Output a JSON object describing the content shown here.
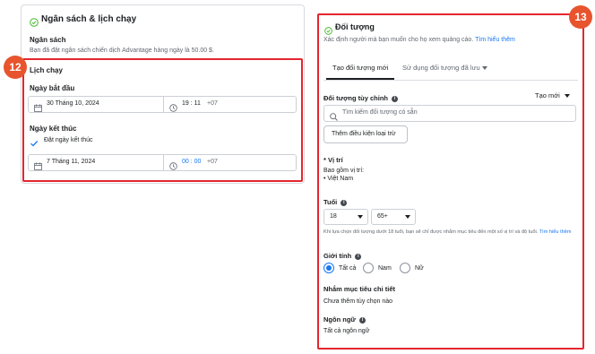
{
  "left_panel": {
    "title": "Ngân sách & lịch chạy",
    "budget_heading": "Ngân sách",
    "budget_text": "Bạn đã đặt ngân sách chiến dịch Advantage hàng ngày là 50.00 $.",
    "schedule_heading": "Lịch chạy",
    "start_label": "Ngày bắt đầu",
    "start_date": "30 Tháng 10, 2024",
    "start_time": "19 : 11",
    "start_tz": "+07",
    "end_label": "Ngày kết thúc",
    "end_checkbox_label": "Đặt ngày kết thúc",
    "end_date": "7 Tháng 11, 2024",
    "end_time": "00 : 00",
    "end_tz": "+07",
    "badge": "12"
  },
  "right_panel": {
    "title": "Đối tượng",
    "description": "Xác định người mà bạn muốn cho họ xem quảng cáo.",
    "learn_more": "Tìm hiểu thêm",
    "tabs": [
      "Tạo đối tượng mới",
      "Sử dụng đối tượng đã lưu"
    ],
    "custom_audience_label": "Đối tượng tùy chỉnh",
    "create_new": "Tạo mới",
    "search_placeholder": "Tìm kiếm đối tượng có sẵn",
    "exclude_button": "Thêm điều kiện loại trừ",
    "location_label": "Vị trí",
    "location_required_mark": "*",
    "location_include": "Bao gồm vị trí:",
    "location_value": "Việt Nam",
    "age_label": "Tuổi",
    "age_min": "18",
    "age_max": "65+",
    "age_note": "Khi lựa chọn đối tượng dưới 18 tuổi, bạn sẽ chỉ được nhắm mục tiêu đến một số vị trí và độ tuổi.",
    "age_note_link": "Tìm hiểu thêm",
    "gender_label": "Giới tính",
    "gender_options": [
      "Tất cả",
      "Nam",
      "Nữ"
    ],
    "gender_selected": 0,
    "detailed_label": "Nhắm mục tiêu chi tiết",
    "detailed_value": "Chưa thêm tùy chọn nào",
    "language_label": "Ngôn ngữ",
    "language_value": "Tất cả ngôn ngữ",
    "badge": "13"
  },
  "colors": {
    "highlight": "#e4262f",
    "badge": "#e8542e",
    "link": "#1877f2",
    "check": "#42b72a"
  }
}
